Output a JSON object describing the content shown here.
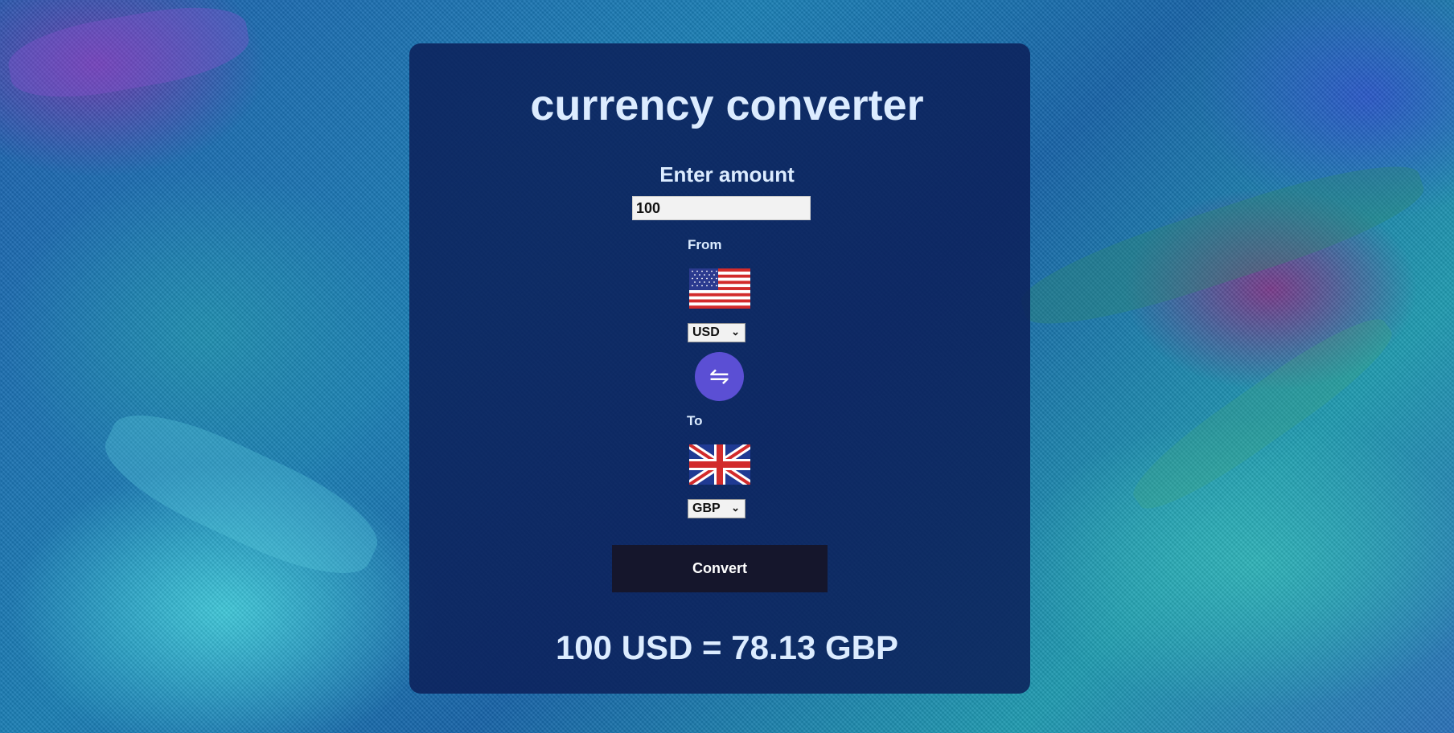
{
  "app": {
    "title": "currency converter"
  },
  "amount": {
    "label": "Enter amount",
    "value": "100"
  },
  "from": {
    "label": "From",
    "currency": "USD",
    "flag": "us-flag-icon"
  },
  "swap": {
    "icon": "swap-arrows-icon",
    "glyph": "⇋"
  },
  "to": {
    "label": "To",
    "currency": "GBP",
    "flag": "uk-flag-icon"
  },
  "convert": {
    "label": "Convert"
  },
  "result": {
    "text": "100 USD = 78.13 GBP"
  },
  "colors": {
    "card": "#0c205a",
    "swap_button": "#5b4fd4",
    "convert_button": "#15162c",
    "text": "#dcecff"
  }
}
